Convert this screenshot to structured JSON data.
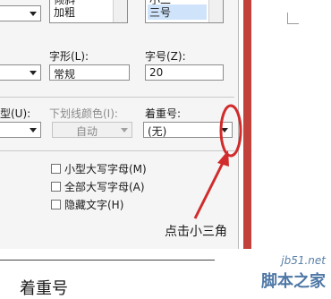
{
  "font_dialog": {
    "style_list": {
      "items": [
        "倾斜",
        "加粗"
      ]
    },
    "size_list": {
      "items": [
        "小二",
        "三号"
      ]
    },
    "font_style_label": "字形(L):",
    "font_style_value": "常规",
    "font_size_label": "字号(Z):",
    "font_size_value": "20",
    "underline_style_label": "型(U):",
    "underline_color_label": "下划线颜色(I):",
    "underline_color_value": "自动",
    "emphasis_label": "着重号:",
    "emphasis_value": "(无)",
    "checkboxes": [
      {
        "label": "小型大写字母(M)",
        "checked": false
      },
      {
        "label": "全部大写字母(A)",
        "checked": false
      },
      {
        "label": "隐藏文字(H)",
        "checked": false
      }
    ]
  },
  "annotation": {
    "text": "点击小三角",
    "color": "#d12b2b"
  },
  "preview_text": "着重号",
  "watermark": {
    "site": "jb51.net",
    "name": "脚本之家"
  }
}
